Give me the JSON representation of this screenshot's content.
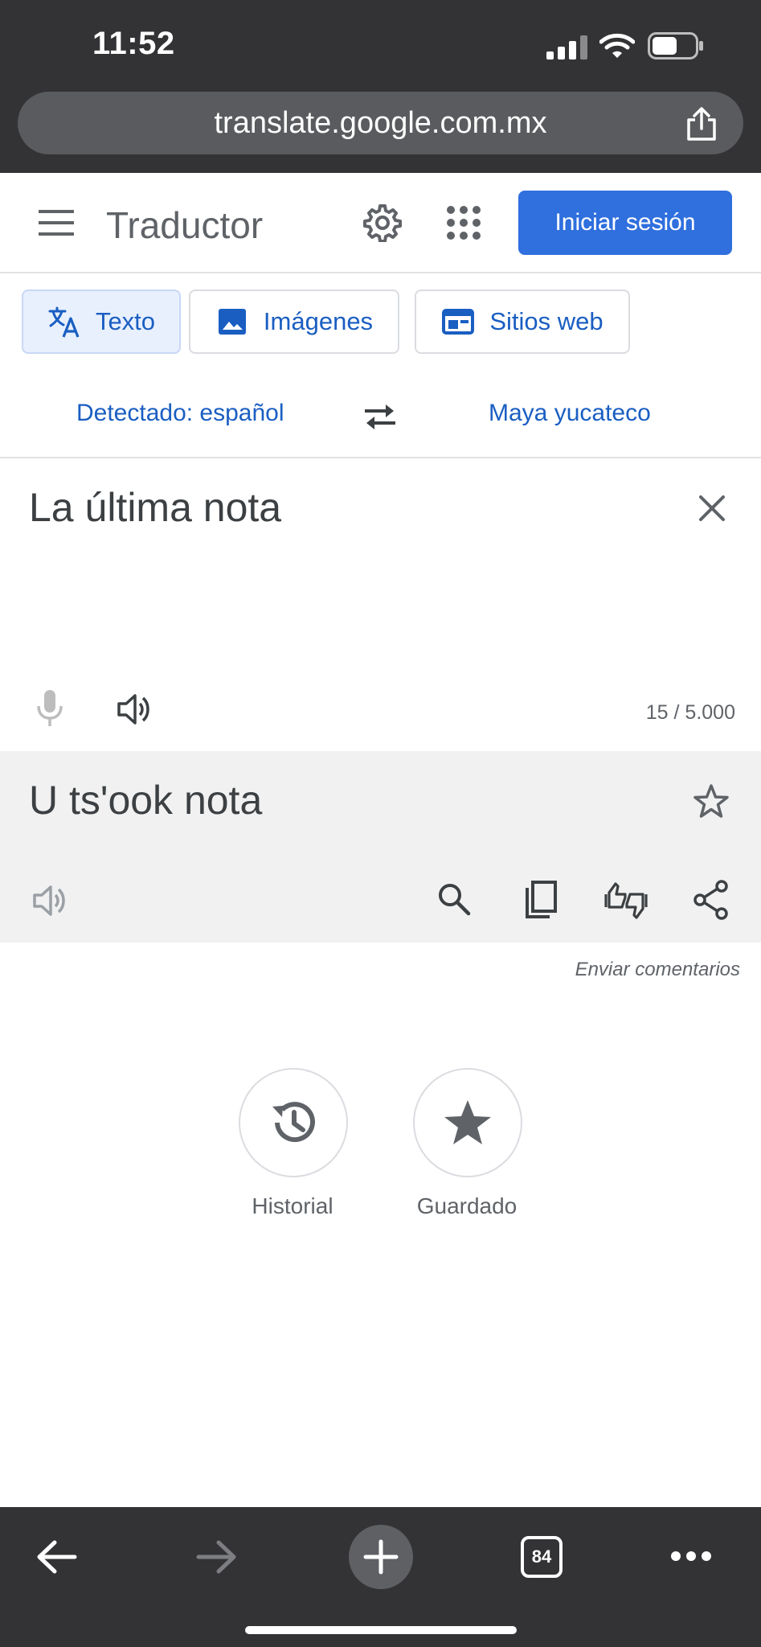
{
  "status_bar": {
    "time": "11:52"
  },
  "browser": {
    "url": "translate.google.com.mx",
    "open_tabs": "84"
  },
  "header": {
    "title": "Traductor",
    "signin_label": "Iniciar sesión"
  },
  "modes": [
    {
      "label": "Texto",
      "icon": "translate-icon",
      "active": true
    },
    {
      "label": "Imágenes",
      "icon": "image-icon",
      "active": false
    },
    {
      "label": "Sitios web",
      "icon": "website-icon",
      "active": false
    }
  ],
  "languages": {
    "source": "Detectado: español",
    "target": "Maya yucateco"
  },
  "input": {
    "text": "La última nota",
    "char_count": "15 / 5.000"
  },
  "output": {
    "text": "U ts'ook nota"
  },
  "feedback_label": "Enviar comentarios",
  "shortcuts": [
    {
      "label": "Historial",
      "icon": "history-icon"
    },
    {
      "label": "Guardado",
      "icon": "saved-star-icon"
    }
  ],
  "colors": {
    "accent": "#2f6fde",
    "link": "#1a5ec2",
    "chrome_dark": "#333335",
    "output_bg": "#f1f1f1"
  }
}
